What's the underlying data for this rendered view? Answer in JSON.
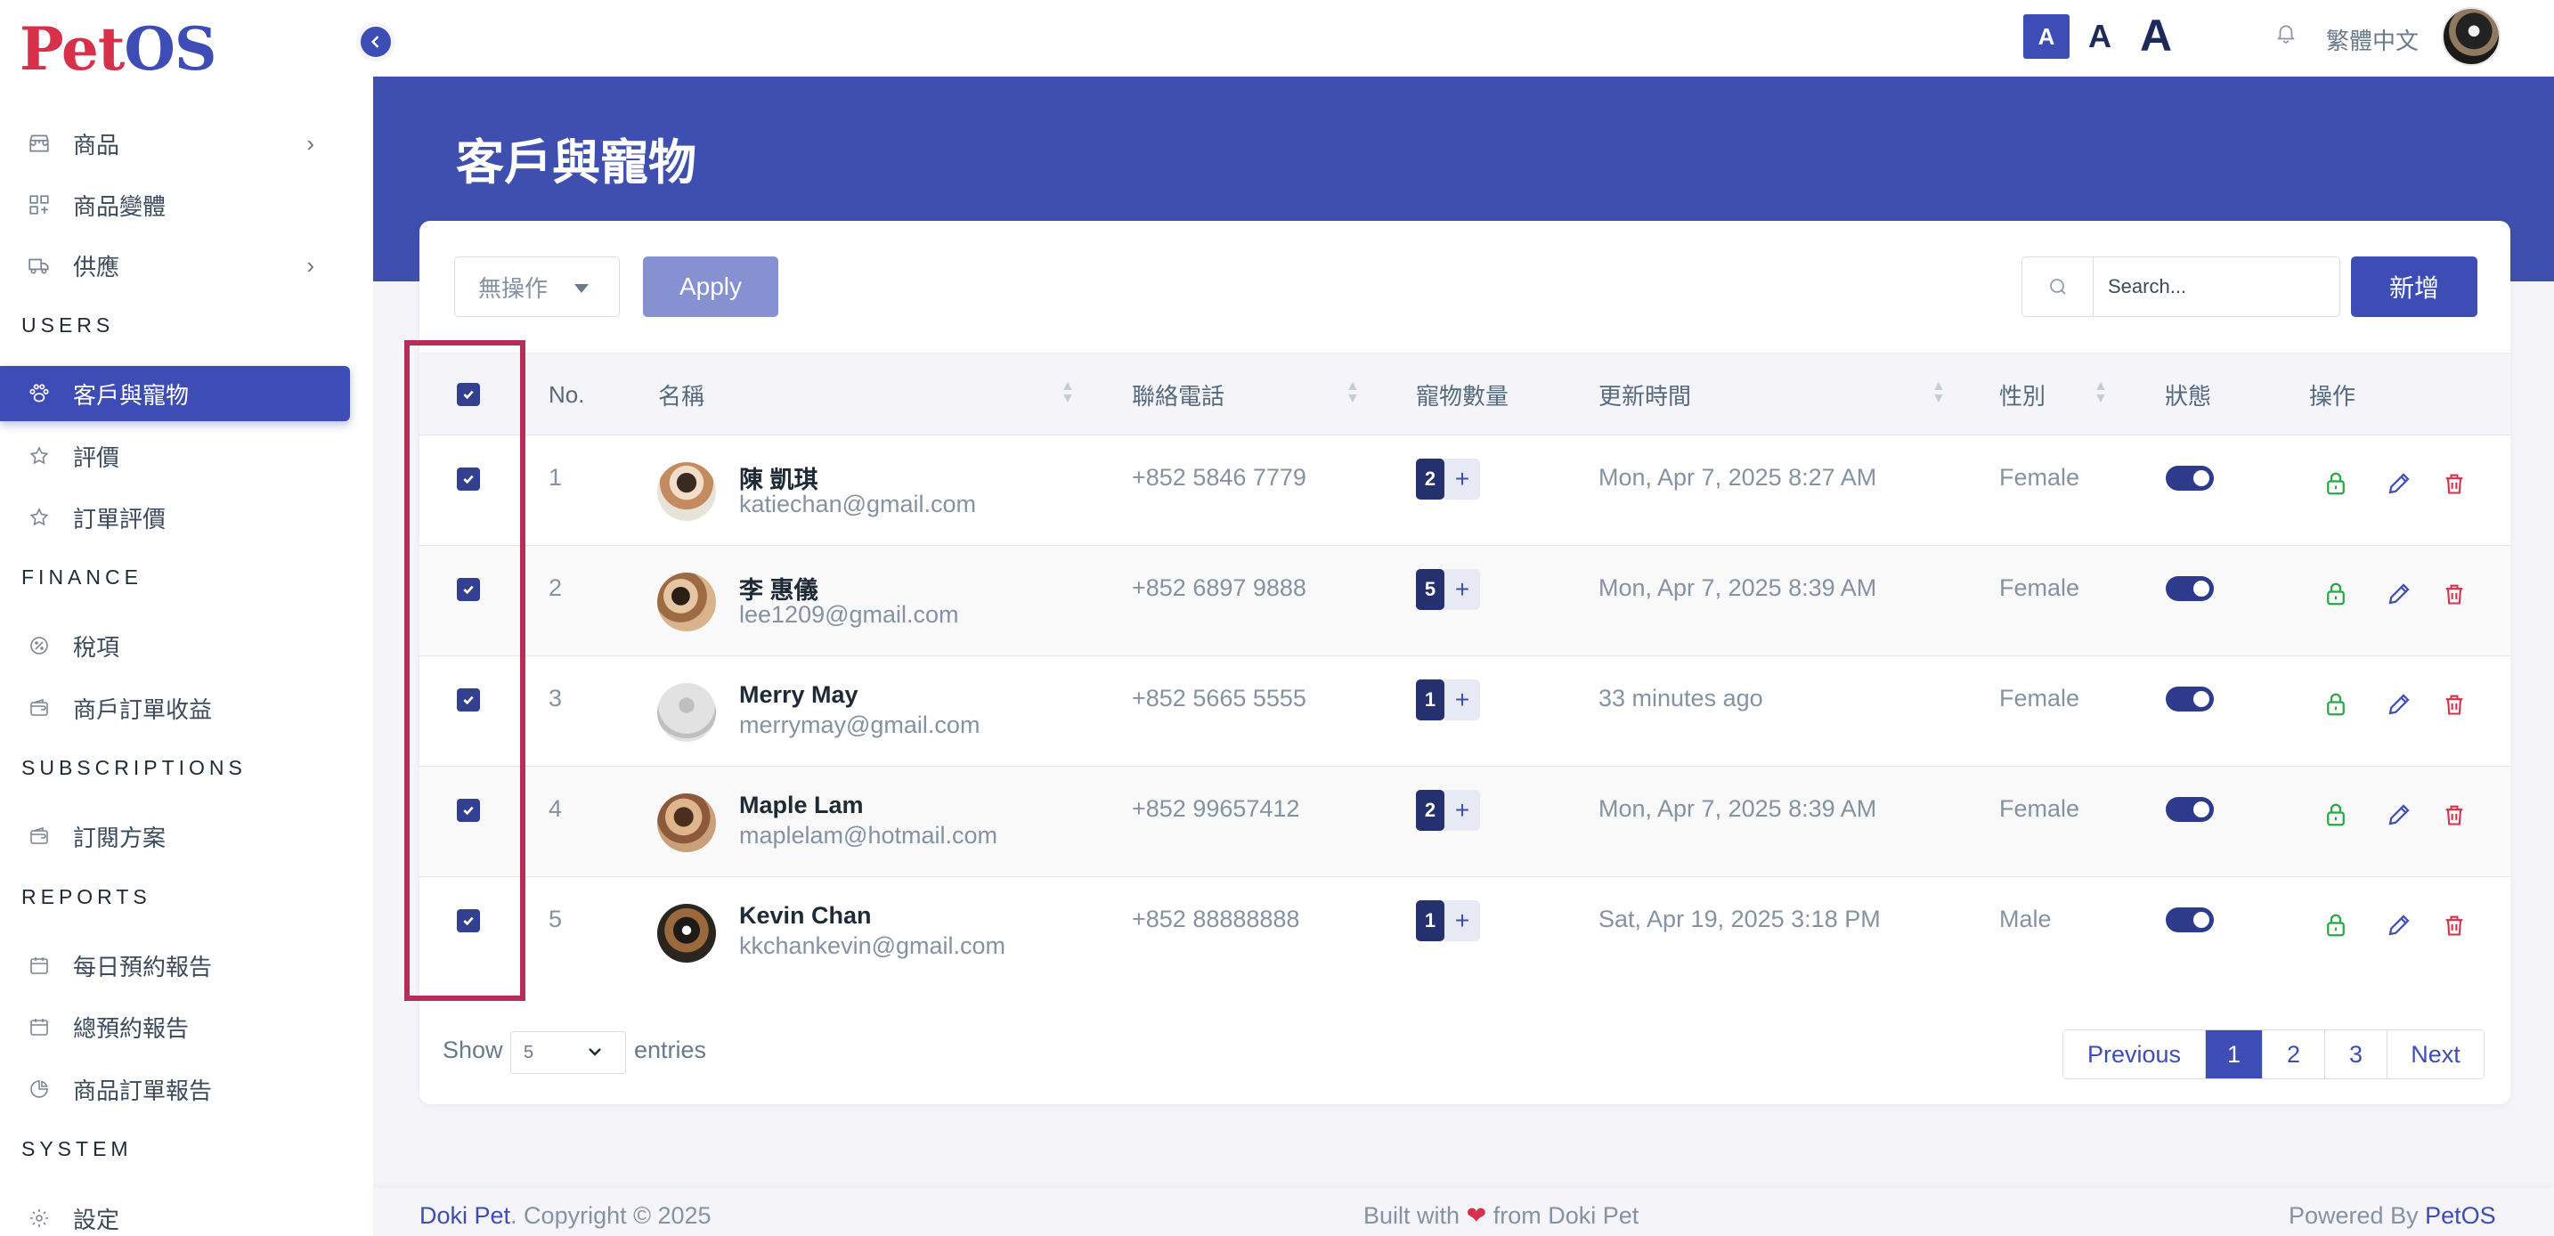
{
  "brand": {
    "logo_part1": "Pet",
    "logo_part2": "OS"
  },
  "sidebar": {
    "items": [
      {
        "label": "商品",
        "icon": "store-icon",
        "has_chevron": true
      },
      {
        "label": "商品變體",
        "icon": "variants-icon",
        "has_chevron": false
      },
      {
        "label": "供應",
        "icon": "truck-icon",
        "has_chevron": true
      }
    ],
    "sections": {
      "users": "USERS",
      "finance": "FINANCE",
      "subscriptions": "SUBSCRIPTIONS",
      "reports": "REPORTS",
      "system": "SYSTEM"
    },
    "users_items": [
      {
        "label": "客戶與寵物",
        "icon": "paw-icon",
        "active": true
      },
      {
        "label": "評價",
        "icon": "star-icon"
      },
      {
        "label": "訂單評價",
        "icon": "star-icon"
      }
    ],
    "finance_items": [
      {
        "label": "稅項",
        "icon": "percent-icon"
      },
      {
        "label": "商戶訂單收益",
        "icon": "wallet-icon"
      }
    ],
    "subscriptions_items": [
      {
        "label": "訂閱方案",
        "icon": "wallet-icon"
      }
    ],
    "reports_items": [
      {
        "label": "每日預約報告",
        "icon": "calendar-icon"
      },
      {
        "label": "總預約報告",
        "icon": "calendar-icon"
      },
      {
        "label": "商品訂單報告",
        "icon": "pie-chart-icon"
      }
    ],
    "system_items": [
      {
        "label": "設定",
        "icon": "gear-icon"
      }
    ]
  },
  "topbar": {
    "font_small": "A",
    "font_medium": "A",
    "font_large": "A",
    "language": "繁體中文"
  },
  "page": {
    "title": "客戶與寵物"
  },
  "toolbar": {
    "bulk_action": "無操作",
    "apply_label": "Apply",
    "search_placeholder": "Search...",
    "add_label": "新增"
  },
  "table": {
    "headers": {
      "no": "No.",
      "name": "名稱",
      "phone": "聯絡電話",
      "pets": "寵物數量",
      "updated": "更新時間",
      "gender": "性別",
      "status": "狀態",
      "actions": "操作"
    },
    "rows": [
      {
        "no": "1",
        "name": "陳 凱琪",
        "email": "katiechan@gmail.com",
        "phone": "+852 5846 7779",
        "pets": "2",
        "updated": "Mon, Apr 7, 2025 8:27 AM",
        "gender": "Female",
        "status": true,
        "checked": true
      },
      {
        "no": "2",
        "name": "李 惠儀",
        "email": "lee1209@gmail.com",
        "phone": "+852 6897 9888",
        "pets": "5",
        "updated": "Mon, Apr 7, 2025 8:39 AM",
        "gender": "Female",
        "status": true,
        "checked": true
      },
      {
        "no": "3",
        "name": "Merry May",
        "email": "merrymay@gmail.com",
        "phone": "+852 5665 5555",
        "pets": "1",
        "updated": "33 minutes ago",
        "gender": "Female",
        "status": true,
        "checked": true
      },
      {
        "no": "4",
        "name": "Maple Lam",
        "email": "maplelam@hotmail.com",
        "phone": "+852 99657412",
        "pets": "2",
        "updated": "Mon, Apr 7, 2025 8:39 AM",
        "gender": "Female",
        "status": true,
        "checked": true
      },
      {
        "no": "5",
        "name": "Kevin Chan",
        "email": "kkchankevin@gmail.com",
        "phone": "+852 88888888",
        "pets": "1",
        "updated": "Sat, Apr 19, 2025 3:18 PM",
        "gender": "Male",
        "status": true,
        "checked": true
      }
    ]
  },
  "pagination": {
    "show_label": "Show",
    "page_size": "5",
    "entries_label": "entries",
    "previous": "Previous",
    "pages": [
      "1",
      "2",
      "3"
    ],
    "current": "1",
    "next": "Next"
  },
  "footer": {
    "company": "Doki Pet",
    "copyright": ". Copyright © 2025",
    "built_prefix": "Built with",
    "built_suffix": "from Doki Pet",
    "powered_prefix": "Powered By",
    "powered_brand": "PetOS"
  },
  "colors": {
    "primary": "#3d4db5",
    "banner": "#3f4fb0",
    "highlight": "#b52e57",
    "success": "#28a745",
    "danger": "#d6304a"
  }
}
